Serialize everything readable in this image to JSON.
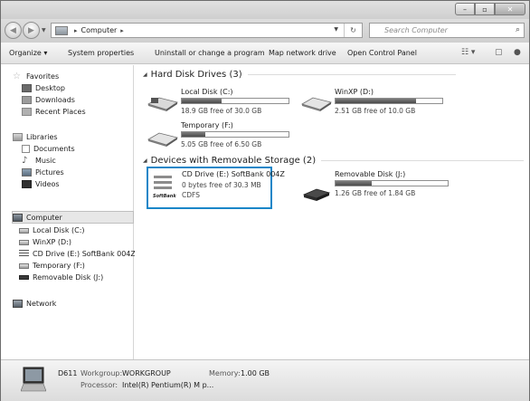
{
  "window": {
    "buttons": {
      "minimize": "–",
      "maximize": "▫",
      "close": "✕"
    }
  },
  "address": {
    "crumbs": [
      "Computer"
    ],
    "separator": "▸",
    "refresh": "↻",
    "search_placeholder": "Search Computer"
  },
  "toolbar": {
    "organize": "Organize ▾",
    "system_properties": "System properties",
    "uninstall": "Uninstall or change a program",
    "map_drive": "Map network drive",
    "control_panel": "Open Control Panel"
  },
  "sidebar": {
    "favorites": {
      "label": "Favorites",
      "items": [
        "Desktop",
        "Downloads",
        "Recent Places"
      ]
    },
    "libraries": {
      "label": "Libraries",
      "items": [
        "Documents",
        "Music",
        "Pictures",
        "Videos"
      ]
    },
    "computer": {
      "label": "Computer",
      "items": [
        "Local Disk (C:)",
        "WinXP (D:)",
        "CD Drive (E:) SoftBank 004Z",
        "Temporary (F:)",
        "Removable Disk (J:)"
      ]
    },
    "network": {
      "label": "Network"
    }
  },
  "content": {
    "hdd_group": "Hard Disk Drives (3)",
    "removable_group": "Devices with Removable Storage (2)",
    "drives": [
      {
        "name": "Local Disk (C:)",
        "free": "18.9 GB free of 30.0 GB",
        "used_fraction": 0.37
      },
      {
        "name": "WinXP (D:)",
        "free": "2.51 GB free of 10.0 GB",
        "used_fraction": 0.75
      },
      {
        "name": "Temporary (F:)",
        "free": "5.05 GB free of 6.50 GB",
        "used_fraction": 0.22
      }
    ],
    "cd": {
      "name": "CD Drive (E:) SoftBank 004Z",
      "free": "0 bytes free of 30.3 MB",
      "fs": "CDFS",
      "logo": "SoftBank"
    },
    "removable": {
      "name": "Removable Disk (J:)",
      "free": "1.26 GB free of 1.84 GB",
      "used_fraction": 0.32
    }
  },
  "status": {
    "pc_name": "D611",
    "workgroup_label": "Workgroup:",
    "workgroup": "WORKGROUP",
    "memory_label": "Memory:",
    "memory": "1.00 GB",
    "processor_label": "Processor:",
    "processor": "Intel(R) Pentium(R) M p..."
  },
  "colors": {
    "selection_border": "#1a86c8"
  }
}
